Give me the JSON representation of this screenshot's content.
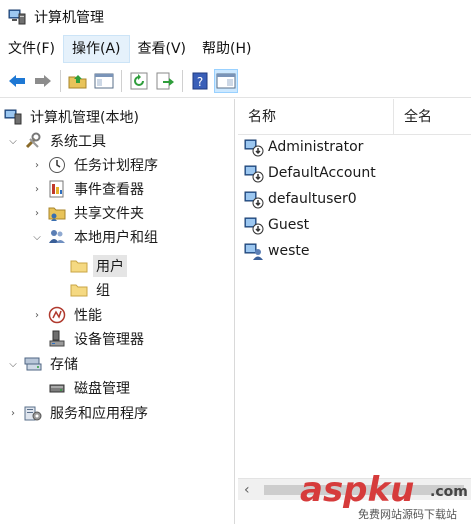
{
  "window": {
    "title": "计算机管理"
  },
  "menu": [
    {
      "label": "文件(F)",
      "active": false
    },
    {
      "label": "操作(A)",
      "active": true
    },
    {
      "label": "查看(V)",
      "active": false
    },
    {
      "label": "帮助(H)",
      "active": false
    }
  ],
  "toolbar": {
    "buttons": [
      "back-icon",
      "forward-icon",
      "up-folder-icon",
      "show-hide-tree-icon",
      "refresh-icon",
      "export-list-icon",
      "help-icon",
      "properties-icon"
    ]
  },
  "tree": {
    "root": "计算机管理(本地)",
    "system_tools": "系统工具",
    "task_scheduler": "任务计划程序",
    "event_viewer": "事件查看器",
    "shared_folders": "共享文件夹",
    "local_users_groups": "本地用户和组",
    "users": "用户",
    "groups": "组",
    "performance": "性能",
    "device_manager": "设备管理器",
    "storage": "存储",
    "disk_management": "磁盘管理",
    "services_apps": "服务和应用程序"
  },
  "list": {
    "columns": {
      "name": "名称",
      "full_name": "全名"
    },
    "rows": [
      "Administrator",
      "DefaultAccount",
      "defaultuser0",
      "Guest",
      "weste"
    ]
  },
  "watermark": {
    "brand": "aspku",
    "tld": ".com",
    "subtitle": "免费网站源码下载站"
  },
  "colors": {
    "menu_active": "#e5f1fb",
    "selected_tree": "#e5e5e5",
    "watermark_red": "#d63b3b"
  }
}
